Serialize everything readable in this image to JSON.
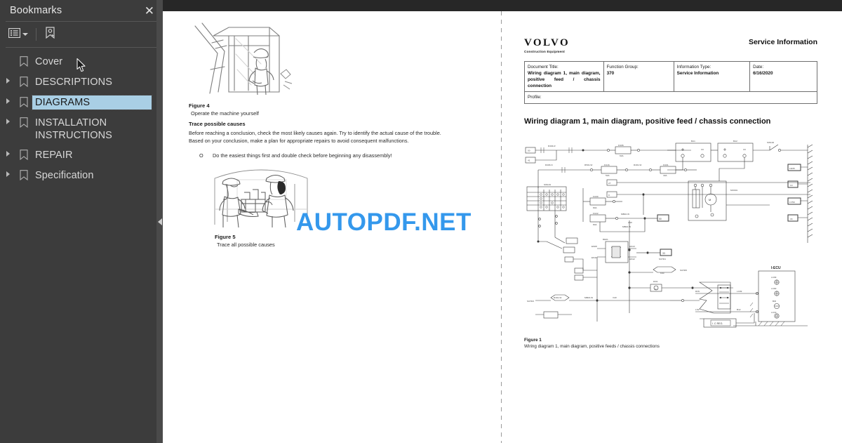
{
  "sidebar": {
    "title": "Bookmarks",
    "close_label": "✕",
    "toolbar": {
      "options_icon": "list-options-icon",
      "options_caret": "chevron-down-icon",
      "new_bookmark_icon": "new-bookmark-icon"
    },
    "collapse_icon": "collapse-left-icon",
    "items": [
      {
        "label": "Cover",
        "expandable": false,
        "selected": false
      },
      {
        "label": "DESCRIPTIONS",
        "expandable": true,
        "selected": false
      },
      {
        "label": "DIAGRAMS",
        "expandable": true,
        "selected": true
      },
      {
        "label": "INSTALLATION INSTRUCTIONS",
        "expandable": true,
        "selected": false
      },
      {
        "label": "REPAIR",
        "expandable": true,
        "selected": false
      },
      {
        "label": "Specification",
        "expandable": true,
        "selected": false
      }
    ]
  },
  "watermark": {
    "text": "AUTOPDF.NET",
    "color": "#3498ec"
  },
  "left_page": {
    "figure4": {
      "number": "Figure 4",
      "caption": "Operate the machine yourself",
      "image_alt": "operator-in-cab-illustration"
    },
    "section_heading": "Trace possible causes",
    "paragraph_line1": "Before reaching a conclusion, check the most likely causes again. Try to identify the actual cause of the trouble.",
    "paragraph_line2": "Based on your conclusion, make a plan for appropriate repairs to avoid consequent malfunctions.",
    "bullet_mark": "O",
    "bullet_text": "Do the easiest things first and double check before beginning any disassembly!",
    "figure5": {
      "number": "Figure 5",
      "caption": "Trace all possible causes",
      "image_alt": "two-workers-inspecting-engine-illustration"
    }
  },
  "right_page": {
    "brand": {
      "wordmark": "VOLVO",
      "tagline": "Construction Equipment"
    },
    "header_right": "Service Information",
    "meta": {
      "document_title_label": "Document Title:",
      "document_title_value": "Wiring diagram 1, main diagram, positive feed / chassis connection",
      "function_group_label": "Function Group:",
      "function_group_value": "370",
      "information_type_label": "Information Type:",
      "information_type_value": "Service Information",
      "date_label": "Date:",
      "date_value": "6/16/2020",
      "profile_label": "Profile:",
      "profile_value": ""
    },
    "title": "Wiring diagram 1, main diagram, positive feed / chassis connection",
    "figure1": {
      "number": "Figure 1",
      "caption": "Wiring diagram 1, main diagram, positive feeds / chassis connections"
    },
    "diagram": {
      "type": "electrical-wiring-schematic",
      "components": [
        "SW101",
        "SW102",
        "BA1",
        "BA2",
        "MO001",
        "I-ECU",
        "I.C REG.",
        "FU06",
        "FU16",
        "FU01",
        "FU09",
        "FU10",
        "FU22",
        "RE01",
        "DI01"
      ],
      "wire_labels": [
        "R404-R",
        "R403-N",
        "R501-W",
        "R401-W",
        "R404-C",
        "R501-W",
        "MB02-W",
        "MB03-W",
        "MB01-W",
        "V/W"
      ],
      "connector_labels": [
        "SCH01",
        "SCH03",
        "SCH05",
        "EN11",
        "EN12",
        "EN13"
      ],
      "terminal_numbers": [
        "50",
        "41",
        "27",
        "9",
        "50",
        "33",
        "15",
        "10"
      ],
      "ecu_pins": [
        "LC09",
        "LC90",
        "B/D",
        "LC19"
      ],
      "fuse_ratings": [
        "60A",
        "50A",
        "40A",
        "80A",
        "30A"
      ]
    }
  }
}
